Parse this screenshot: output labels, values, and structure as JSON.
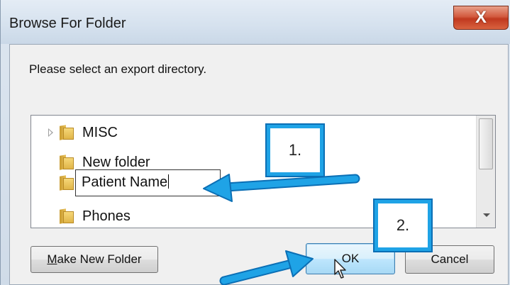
{
  "window": {
    "title": "Browse For Folder",
    "close_glyph": "X"
  },
  "prompt": "Please select an export directory.",
  "tree": {
    "items": [
      {
        "label": "MISC",
        "icon": "folder-icon",
        "expandable": true
      },
      {
        "label": "New folder",
        "icon": "folder-icon",
        "expandable": false
      },
      {
        "label": "Patient Name",
        "icon": "folder-icon",
        "editing": true
      },
      {
        "label": "Phones",
        "icon": "folder-icon",
        "expandable": false
      }
    ]
  },
  "buttons": {
    "make_new_folder": {
      "mnemonic": "M",
      "rest": "ake New Folder"
    },
    "ok": "OK",
    "cancel": "Cancel"
  },
  "annotations": {
    "callout_1": "1.",
    "callout_2": "2.",
    "accent_color": "#1fa3e6"
  }
}
